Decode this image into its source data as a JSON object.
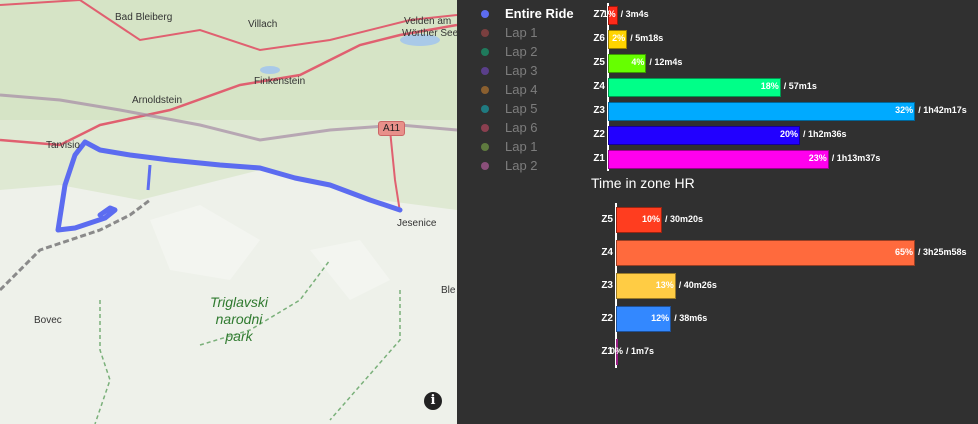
{
  "map": {
    "places": [
      "Bad Bleiberg",
      "Villach",
      "Velden am",
      "Wörther See",
      "Finkenstein",
      "Arnoldstein",
      "Tarvisio",
      "Jesenice",
      "Bovec",
      "Ble"
    ],
    "park_lines": [
      "Triglavski",
      "narodni",
      "park"
    ],
    "road_badge": "A11",
    "info_icon": "i"
  },
  "legend": {
    "items": [
      {
        "label": "Entire Ride",
        "color": "#5c6cf0",
        "active": true
      },
      {
        "label": "Lap 1",
        "color": "#7a3f3f",
        "active": false
      },
      {
        "label": "Lap 2",
        "color": "#1f7a5c",
        "active": false
      },
      {
        "label": "Lap 3",
        "color": "#5a3f8a",
        "active": false
      },
      {
        "label": "Lap 4",
        "color": "#8a5f2f",
        "active": false
      },
      {
        "label": "Lap 5",
        "color": "#1f7a80",
        "active": false
      },
      {
        "label": "Lap 6",
        "color": "#8a3f4f",
        "active": false
      },
      {
        "label": "Lap 1",
        "color": "#5f7a3f",
        "active": false
      },
      {
        "label": "Lap 2",
        "color": "#8a4f7a",
        "active": false
      }
    ]
  },
  "chart_data": [
    {
      "type": "bar",
      "title": "",
      "categories": [
        "Z7",
        "Z6",
        "Z5",
        "Z4",
        "Z3",
        "Z2",
        "Z1"
      ],
      "values": [
        1,
        2,
        4,
        18,
        32,
        20,
        23
      ],
      "pct_labels": [
        "1%",
        "2%",
        "4%",
        "18%",
        "32%",
        "20%",
        "23%"
      ],
      "time_labels": [
        "/ 3m4s",
        "/ 5m18s",
        "/ 12m4s",
        "/ 57m1s",
        "/ 1h42m17s",
        "/ 1h2m36s",
        "/ 1h13m37s"
      ],
      "colors": [
        "#ff2a1a",
        "#ffd400",
        "#66ff00",
        "#00ff88",
        "#00aaff",
        "#2200ff",
        "#ff00ee"
      ]
    },
    {
      "type": "bar",
      "title": "Time in zone HR",
      "categories": [
        "Z5",
        "Z4",
        "Z3",
        "Z2",
        "Z1"
      ],
      "values": [
        10,
        65,
        13,
        12,
        0
      ],
      "pct_labels": [
        "10%",
        "65%",
        "13%",
        "12%",
        "0%"
      ],
      "time_labels": [
        "/ 30m20s",
        "/ 3h25m58s",
        "/ 40m26s",
        "/ 38m6s",
        "/ 1m7s"
      ],
      "colors": [
        "#ff3d1f",
        "#ff6a3d",
        "#ffcc44",
        "#3388ff",
        "#ff33dd"
      ]
    }
  ]
}
